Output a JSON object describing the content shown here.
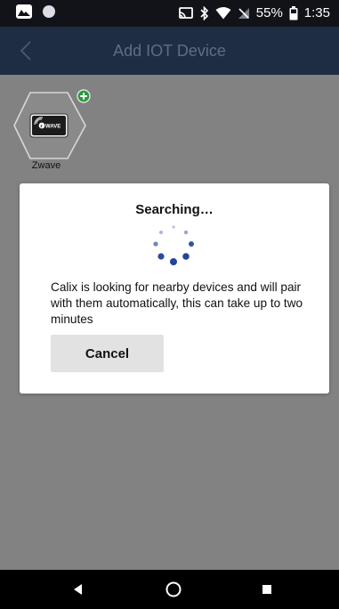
{
  "status_bar": {
    "battery_percent": "55%",
    "time": "1:35",
    "icons": [
      "gallery-icon",
      "circle-icon",
      "cast-icon",
      "bluetooth-icon",
      "wifi-icon",
      "no-signal-icon",
      "battery-icon"
    ]
  },
  "header": {
    "title": "Add IOT Device",
    "back_icon": "chevron-left-icon"
  },
  "devices": [
    {
      "label": "Zwave",
      "logo_text": "WAVE",
      "badge_icon": "plus-badge-icon"
    }
  ],
  "dialog": {
    "title": "Searching…",
    "message": "Calix is looking for nearby devices and will pair with them automatically, this can take up to two minutes",
    "cancel_label": "Cancel",
    "spinner_icon": "loading-spinner-icon"
  },
  "nav_bar": {
    "back_icon": "nav-back-icon",
    "home_icon": "nav-home-icon",
    "recents_icon": "nav-recents-icon"
  },
  "colors": {
    "status_bar": "#111318",
    "header": "#1e2d44",
    "header_title": "#5c6e83",
    "background_dim": "#828282",
    "accent_green": "#2e9a3f",
    "spinner_blue": "#27449a"
  }
}
